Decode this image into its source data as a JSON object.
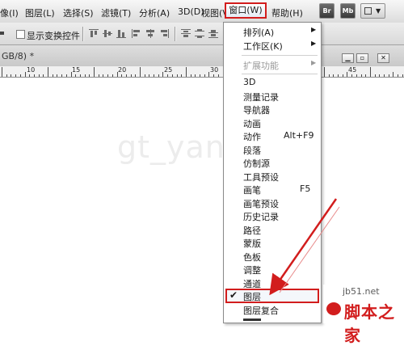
{
  "menubar": {
    "items": [
      "像(I)",
      "图层(L)",
      "选择(S)",
      "滤镜(T)",
      "分析(A)",
      "3D(D)",
      "视图(V)"
    ],
    "window": "窗口(W)",
    "help": "帮助(H)",
    "btn_br": "Br",
    "btn_mb": "Mb"
  },
  "options": {
    "show_transform": "显示变换控件"
  },
  "document": {
    "title": "GB/8) *"
  },
  "ruler": {
    "labels": [
      "10",
      "15",
      "20",
      "25",
      "30",
      "45"
    ]
  },
  "canvas": {
    "watermark": "gt_yanzi"
  },
  "menu": {
    "arrange": "排列(A)",
    "workspace": "工作区(K)",
    "extensions": "扩展功能",
    "items": [
      {
        "label": "3D",
        "shortcut": ""
      },
      {
        "label": "测量记录",
        "shortcut": ""
      },
      {
        "label": "导航器",
        "shortcut": ""
      },
      {
        "label": "动画",
        "shortcut": ""
      },
      {
        "label": "动作",
        "shortcut": "Alt+F9"
      },
      {
        "label": "段落",
        "shortcut": ""
      },
      {
        "label": "仿制源",
        "shortcut": ""
      },
      {
        "label": "工具预设",
        "shortcut": ""
      },
      {
        "label": "画笔",
        "shortcut": "F5"
      },
      {
        "label": "画笔预设",
        "shortcut": ""
      },
      {
        "label": "历史记录",
        "shortcut": ""
      },
      {
        "label": "路径",
        "shortcut": ""
      },
      {
        "label": "蒙版",
        "shortcut": ""
      },
      {
        "label": "色板",
        "shortcut": ""
      },
      {
        "label": "调整",
        "shortcut": ""
      },
      {
        "label": "通道",
        "shortcut": ""
      }
    ],
    "layers": "图层",
    "layer_comps": "图层复合",
    "checkmark": "✔"
  },
  "brand": {
    "url": "jb51.net",
    "name": "脚本之家"
  },
  "colors": {
    "annotation": "#d21d1d"
  }
}
